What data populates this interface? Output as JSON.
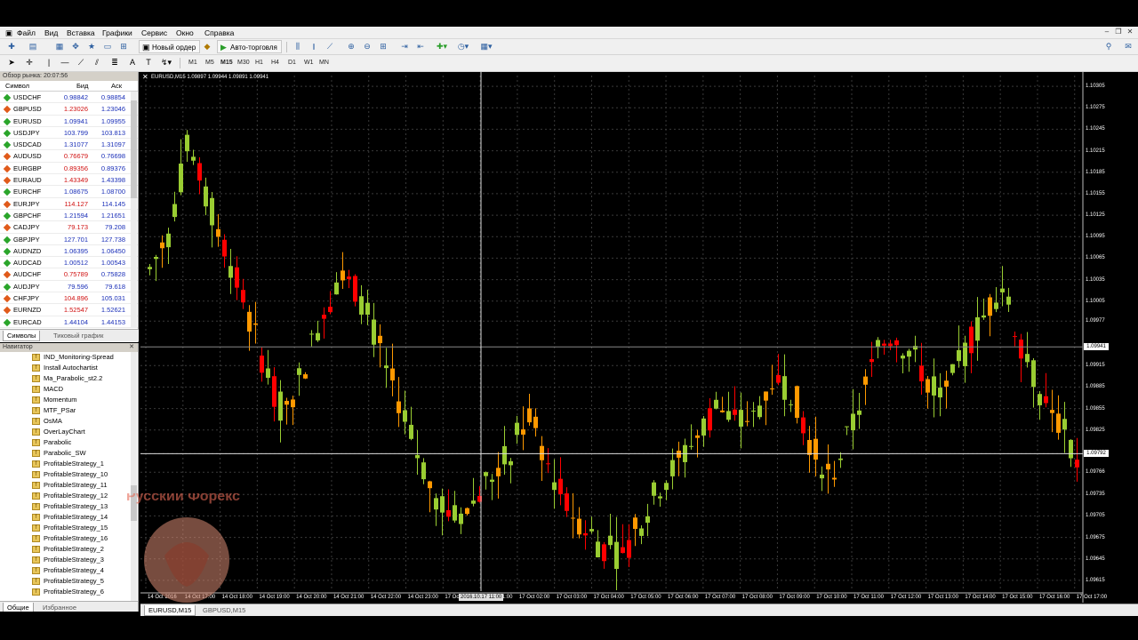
{
  "menu": [
    "Файл",
    "Вид",
    "Вставка",
    "Графики",
    "Сервис",
    "Окно",
    "Справка"
  ],
  "toolbar": {
    "new_order": "Новый ордер",
    "auto_trading": "Авто-торговля",
    "timeframes": [
      "M1",
      "M5",
      "M15",
      "M30",
      "H1",
      "H4",
      "D1",
      "W1",
      "MN"
    ]
  },
  "market_watch": {
    "title": "Обзор рынка: 20:07:56",
    "col_symbol": "Символ",
    "col_bid": "Бид",
    "col_ask": "Аск",
    "rows": [
      {
        "symbol": "USDCHF",
        "bid": "0.98842",
        "ask": "0.98854",
        "dir": "up"
      },
      {
        "symbol": "GBPUSD",
        "bid": "1.23026",
        "ask": "1.23046",
        "dir": "down"
      },
      {
        "symbol": "EURUSD",
        "bid": "1.09941",
        "ask": "1.09955",
        "dir": "up"
      },
      {
        "symbol": "USDJPY",
        "bid": "103.799",
        "ask": "103.813",
        "dir": "up"
      },
      {
        "symbol": "USDCAD",
        "bid": "1.31077",
        "ask": "1.31097",
        "dir": "up"
      },
      {
        "symbol": "AUDUSD",
        "bid": "0.76679",
        "ask": "0.76698",
        "dir": "down"
      },
      {
        "symbol": "EURGBP",
        "bid": "0.89356",
        "ask": "0.89376",
        "dir": "down"
      },
      {
        "symbol": "EURAUD",
        "bid": "1.43349",
        "ask": "1.43398",
        "dir": "down"
      },
      {
        "symbol": "EURCHF",
        "bid": "1.08675",
        "ask": "1.08700",
        "dir": "up"
      },
      {
        "symbol": "EURJPY",
        "bid": "114.127",
        "ask": "114.145",
        "dir": "down"
      },
      {
        "symbol": "GBPCHF",
        "bid": "1.21594",
        "ask": "1.21651",
        "dir": "up"
      },
      {
        "symbol": "CADJPY",
        "bid": "79.173",
        "ask": "79.208",
        "dir": "down"
      },
      {
        "symbol": "GBPJPY",
        "bid": "127.701",
        "ask": "127.738",
        "dir": "up"
      },
      {
        "symbol": "AUDNZD",
        "bid": "1.06395",
        "ask": "1.06450",
        "dir": "up"
      },
      {
        "symbol": "AUDCAD",
        "bid": "1.00512",
        "ask": "1.00543",
        "dir": "up"
      },
      {
        "symbol": "AUDCHF",
        "bid": "0.75789",
        "ask": "0.75828",
        "dir": "down"
      },
      {
        "symbol": "AUDJPY",
        "bid": "79.596",
        "ask": "79.618",
        "dir": "up"
      },
      {
        "symbol": "CHFJPY",
        "bid": "104.896",
        "ask": "105.031",
        "dir": "down"
      },
      {
        "symbol": "EURNZD",
        "bid": "1.52547",
        "ask": "1.52621",
        "dir": "down"
      },
      {
        "symbol": "EURCAD",
        "bid": "1.44104",
        "ask": "1.44153",
        "dir": "up"
      }
    ],
    "tabs": [
      "Символы",
      "Тиковый график"
    ]
  },
  "navigator": {
    "title": "Навигатор",
    "items": [
      "IND_Monitoring-Spread",
      "Install Autochartist",
      "Ma_Parabolic_st2.2",
      "MACD",
      "Momentum",
      "MTF_PSar",
      "OsMA",
      "OverLayChart",
      "Parabolic",
      "Parabolic_SW",
      "ProfitableStrategy_1",
      "ProfitableStrategy_10",
      "ProfitableStrategy_11",
      "ProfitableStrategy_12",
      "ProfitableStrategy_13",
      "ProfitableStrategy_14",
      "ProfitableStrategy_15",
      "ProfitableStrategy_16",
      "ProfitableStrategy_2",
      "ProfitableStrategy_3",
      "ProfitableStrategy_4",
      "ProfitableStrategy_5",
      "ProfitableStrategy_6"
    ],
    "tabs": [
      "Общие",
      "Избранное"
    ]
  },
  "watermark_text": "Русский Форекс",
  "chart_tabs": [
    "EURUSD,M15",
    "GBPUSD,M15"
  ],
  "colors": {
    "bull": "#9acd32",
    "bear": "#ff0000",
    "accent_orange": "#ff9900",
    "grid": "#3a3a3a",
    "background": "#000000"
  },
  "chart_data": {
    "type": "candlestick",
    "title": "EURUSD,M15  1.09897 1.09944 1.09891 1.09941",
    "symbol": "EURUSD",
    "timeframe": "M15",
    "y_ticks": [
      "1.10305",
      "1.10275",
      "1.10245",
      "1.10215",
      "1.10185",
      "1.10155",
      "1.10125",
      "1.10095",
      "1.10065",
      "1.10035",
      "1.10005",
      "1.09977",
      "1.09941",
      "1.09915",
      "1.09885",
      "1.09855",
      "1.09825",
      "1.09792",
      "1.09766",
      "1.09735",
      "1.09705",
      "1.09675",
      "1.09645",
      "1.09615"
    ],
    "ylim": [
      1.096,
      1.1032
    ],
    "current_price": "1.09941",
    "crosshair_price": "1.09792",
    "crosshair_time": "2016.10.17 11:00",
    "x_ticks": [
      "14 Oct 2016",
      "14 Oct 17:00",
      "14 Oct 18:00",
      "14 Oct 19:00",
      "14 Oct 20:00",
      "14 Oct 21:00",
      "14 Oct 22:00",
      "14 Oct 23:00",
      "17 Oct 00:00",
      "17 Oct 01:00",
      "17 Oct 02:00",
      "17 Oct 03:00",
      "17 Oct 04:00",
      "17 Oct 05:00",
      "17 Oct 06:00",
      "17 Oct 07:00",
      "17 Oct 08:00",
      "17 Oct 09:00",
      "17 Oct 10:00",
      "17 Oct 11:00",
      "17 Oct 12:00",
      "17 Oct 13:00",
      "17 Oct 14:00",
      "17 Oct 15:00",
      "17 Oct 16:00",
      "17 Oct 17:00"
    ]
  }
}
